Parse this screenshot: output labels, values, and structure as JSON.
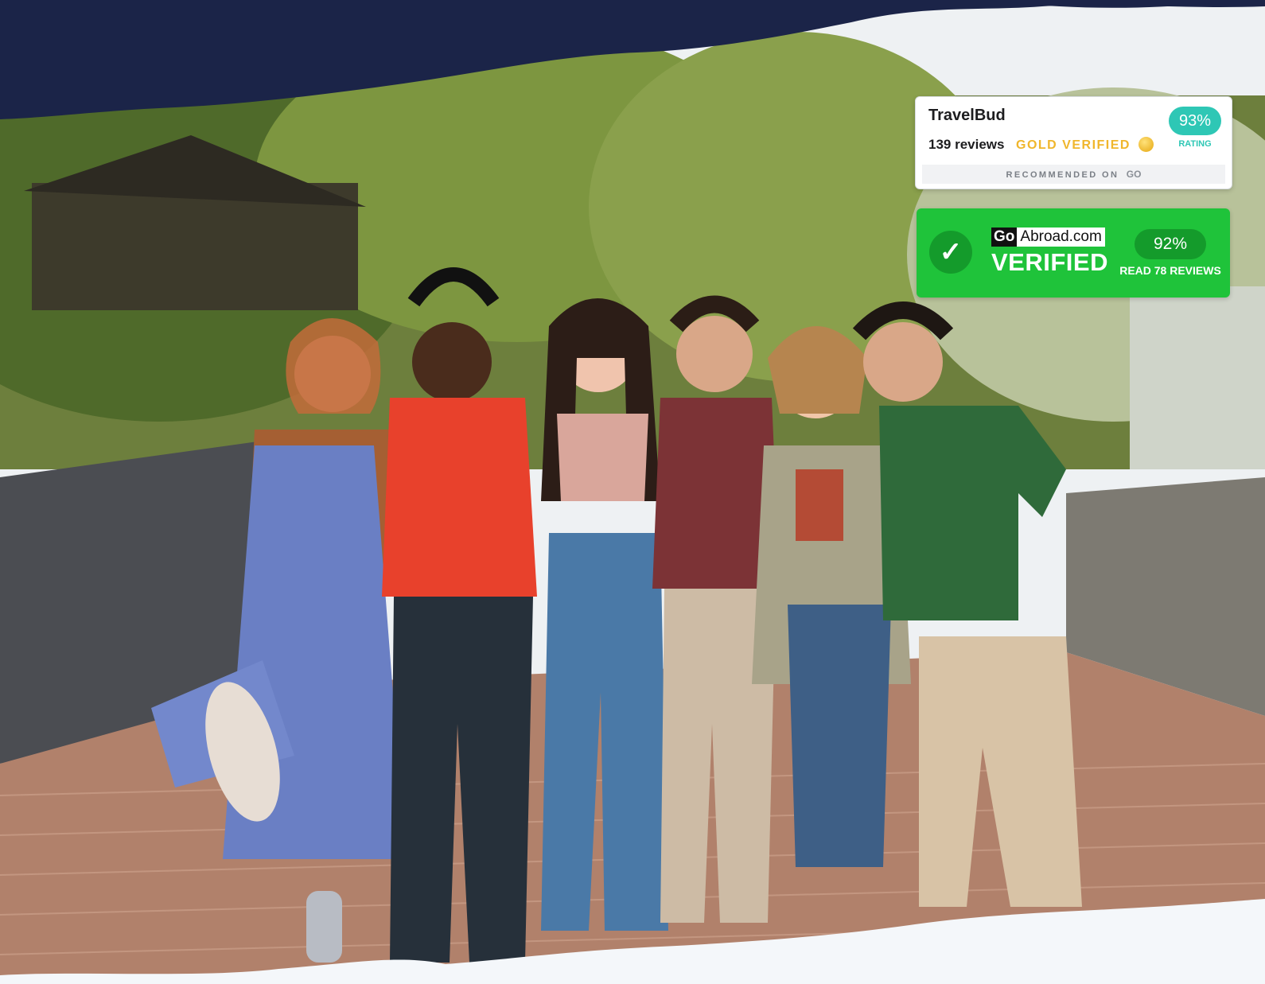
{
  "travelbud_badge": {
    "name": "TravelBud",
    "reviews": "139 reviews",
    "gold_verified": "GOLD VERIFIED",
    "rating_percent": "93%",
    "rating_label": "RATING",
    "recommended_on": "RECOMMENDED ON",
    "go_logo": "GO",
    "icon": "gold-verified-icon"
  },
  "goabroad_badge": {
    "logo_go": "Go",
    "logo_rest": "Abroad.com",
    "verified": "VERIFIED",
    "rating_percent": "92%",
    "read_reviews": "READ 78 REVIEWS",
    "icon": "check-icon"
  },
  "colors": {
    "header_navy": "#1b2448",
    "travelbud_teal": "#2ec7b5",
    "gold": "#f0b62c",
    "goabroad_green": "#1fc33a"
  }
}
